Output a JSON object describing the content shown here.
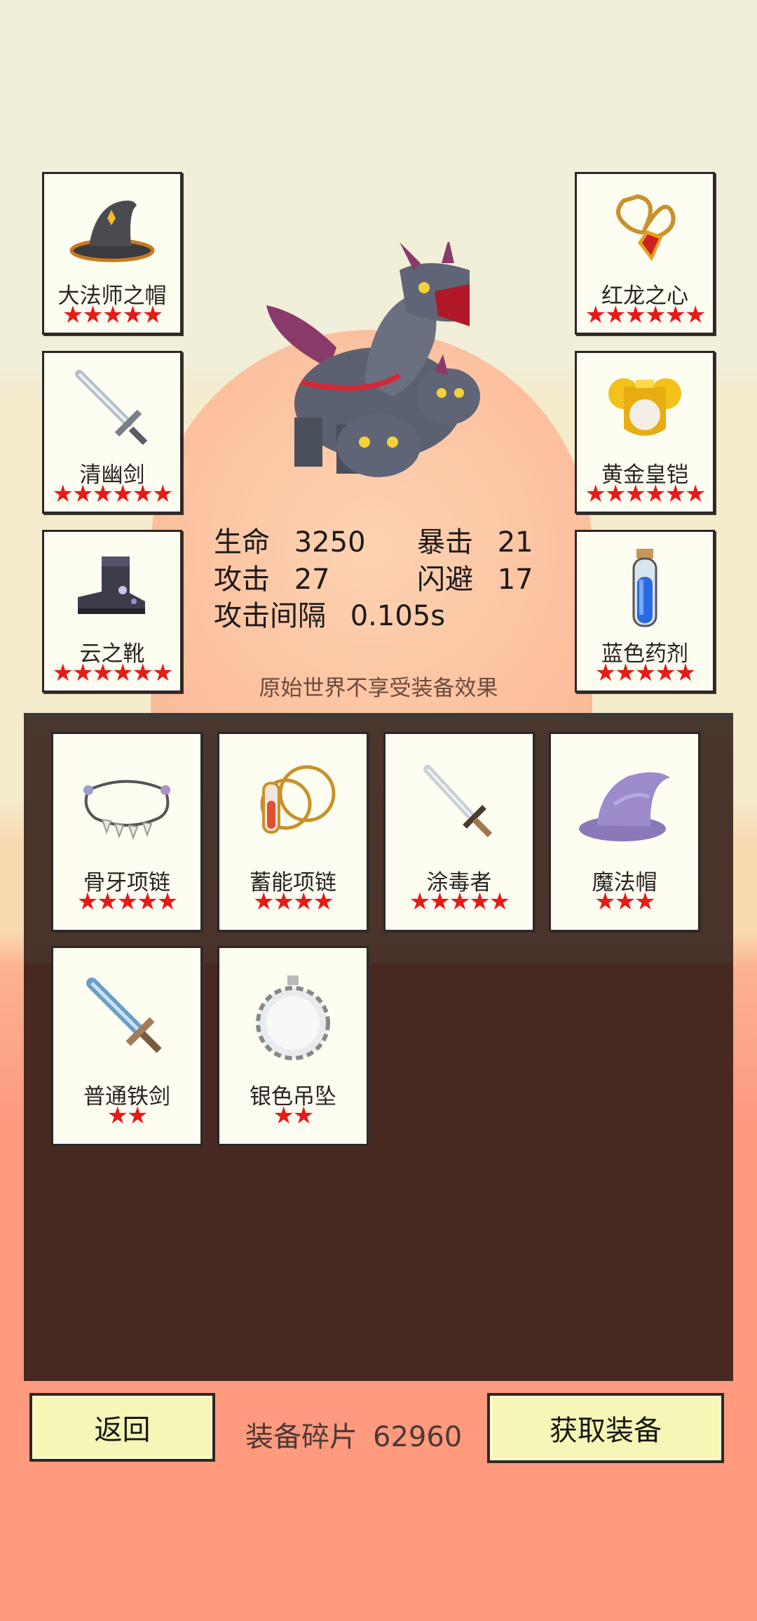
{
  "left_equipment": [
    {
      "name": "大法师之帽",
      "stars": "★★★★★"
    },
    {
      "name": "清幽剑",
      "stars": "★★★★★★"
    },
    {
      "name": "云之靴",
      "stars": "★★★★★★"
    }
  ],
  "right_equipment": [
    {
      "name": "红龙之心",
      "stars": "★★★★★★"
    },
    {
      "name": "黄金皇铠",
      "stars": "★★★★★★"
    },
    {
      "name": "蓝色药剂",
      "stars": "★★★★★"
    }
  ],
  "stats": {
    "hp_label": "生命",
    "hp_value": "3250",
    "crit_label": "暴击",
    "crit_value": "21",
    "atk_label": "攻击",
    "atk_value": "27",
    "dodge_label": "闪避",
    "dodge_value": "17",
    "interval_label": "攻击间隔",
    "interval_value": "0.105s"
  },
  "notice": "原始世界不享受装备效果",
  "inventory": [
    {
      "name": "骨牙项链",
      "stars": "★★★★★",
      "icon": "bone-necklace-icon"
    },
    {
      "name": "蓄能项链",
      "stars": "★★★★",
      "icon": "charge-necklace-icon"
    },
    {
      "name": "涂毒者",
      "stars": "★★★★★",
      "icon": "dagger-icon"
    },
    {
      "name": "魔法帽",
      "stars": "★★★",
      "icon": "purple-wizard-hat-icon"
    },
    {
      "name": "普通铁剑",
      "stars": "★★",
      "icon": "iron-sword-icon"
    },
    {
      "name": "银色吊坠",
      "stars": "★★",
      "icon": "silver-pendant-icon"
    }
  ],
  "footer": {
    "back_label": "返回",
    "shards_label": "装备碎片",
    "shards_value": "62960",
    "get_label": "获取装备"
  },
  "colors": {
    "star": "#e51b17",
    "panel": "#482921",
    "button": "#f6f7b6"
  }
}
